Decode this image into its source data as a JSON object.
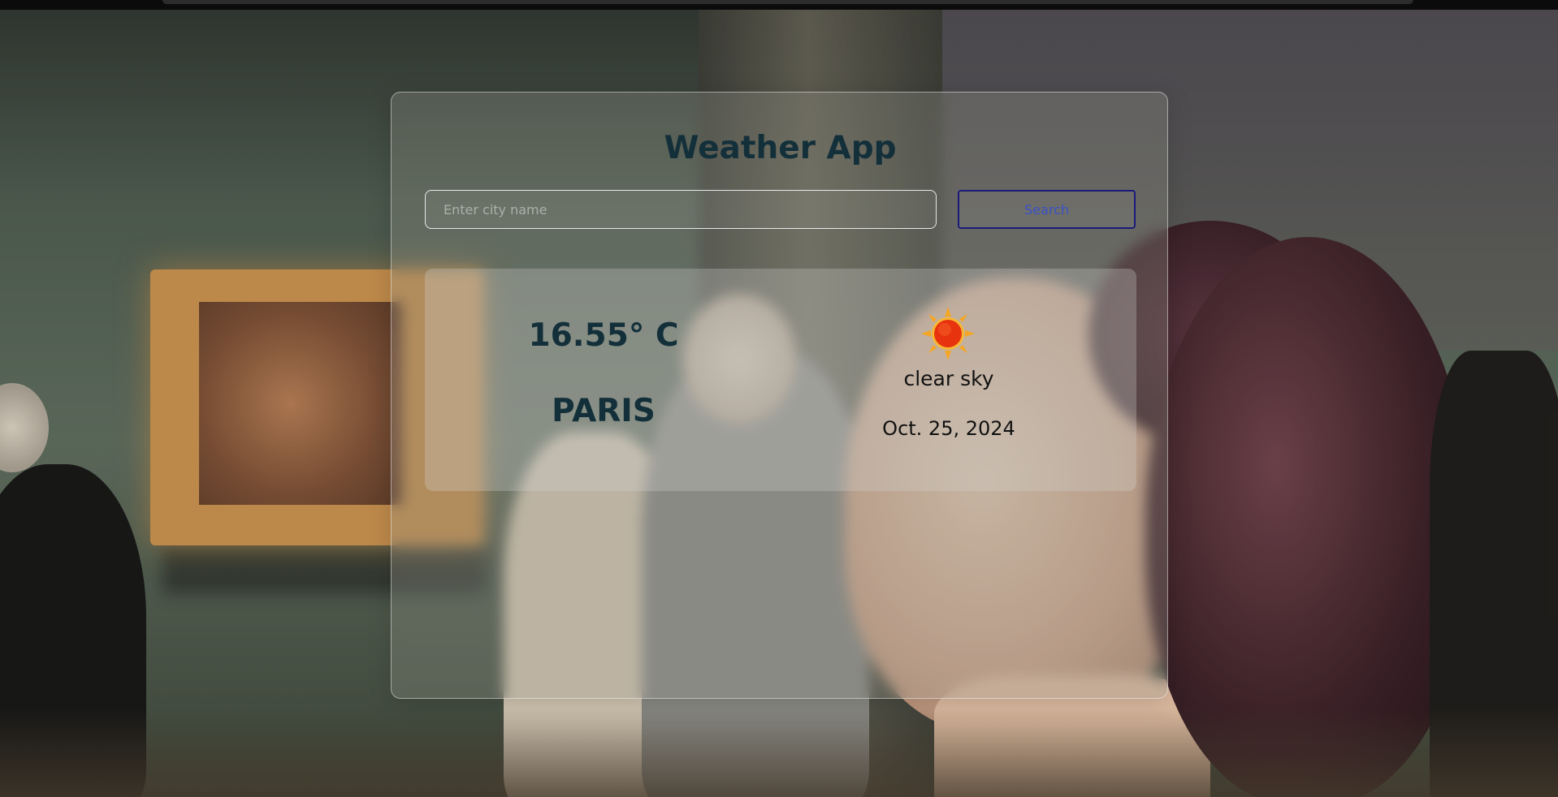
{
  "app": {
    "title": "Weather App"
  },
  "search": {
    "placeholder": "Enter city name",
    "value": "",
    "button_label": "Search"
  },
  "weather": {
    "temperature": "16.55° C",
    "city": "PARIS",
    "description": "clear sky",
    "date": "Oct. 25, 2024",
    "icon": "sun-icon"
  },
  "colors": {
    "title_text": "#13303a",
    "button_border": "#1b1a7a",
    "button_text": "#3a52c8"
  }
}
